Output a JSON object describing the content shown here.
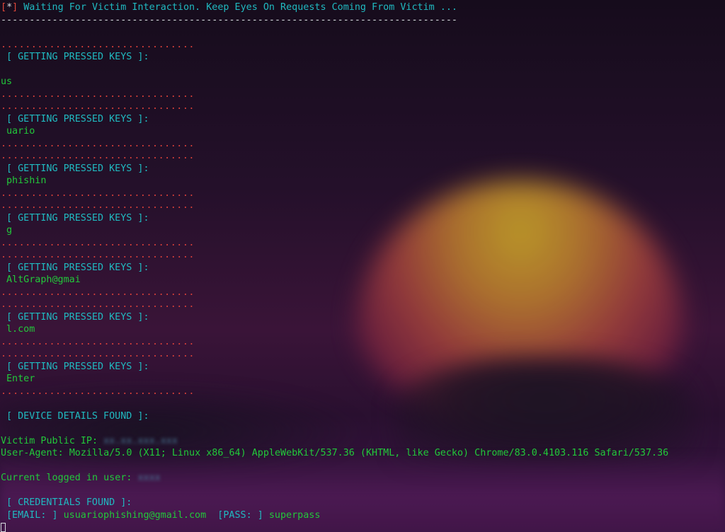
{
  "header": {
    "bracket_open": "[",
    "star": "*",
    "bracket_close": "]",
    "message": " Waiting For Victim Interaction. Keep Eyes On Requests Coming From Victim ...",
    "rule": "--------------------------------------------------------------------------------"
  },
  "dots": "................................",
  "keys_header": "[ GETTING PRESSED KEYS ]:",
  "keystrokes": [
    "us",
    "uario",
    "phishin",
    "g",
    "AltGraph@gmai",
    "l.com",
    "Enter"
  ],
  "device": {
    "header": "[ DEVICE DETAILS FOUND ]:",
    "ip_label": "Victim Public IP: ",
    "ip_value": "xx.xx.xxx.xxx",
    "ua_label": "User-Agent: ",
    "ua_value": "Mozilla/5.0 (X11; Linux x86_64) AppleWebKit/537.36 (KHTML, like Gecko) Chrome/83.0.4103.116 Safari/537.36",
    "user_label": "Current logged in user: ",
    "user_value": "xxxx"
  },
  "credentials": {
    "header": "[ CREDENTIALS FOUND ]:",
    "email_label": "[EMAIL: ]",
    "email_value": "usuariophishing@gmail.com",
    "pass_label": "[PASS: ]",
    "pass_value": "superpass"
  },
  "colors": {
    "accent_cyan": "#20b9c0",
    "text_green": "#22c83a",
    "dots_red": "#d9403a",
    "text_white": "#d8dce0"
  }
}
